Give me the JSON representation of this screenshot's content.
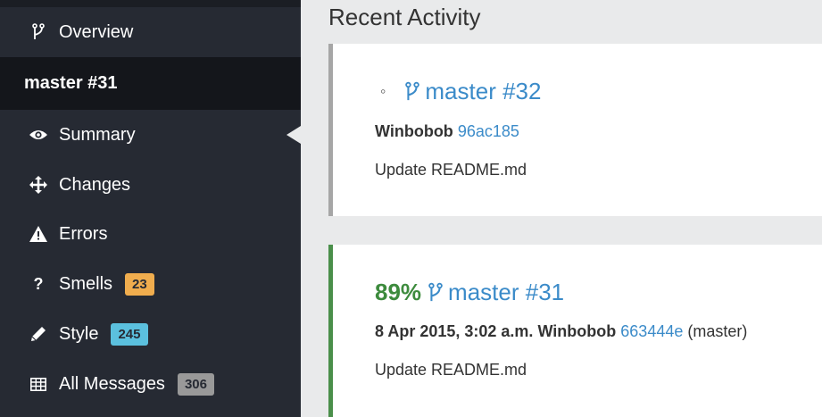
{
  "sidebar": {
    "overview_label": "Overview",
    "header": "master #31",
    "items": [
      {
        "label": "Summary",
        "icon": "eye-icon"
      },
      {
        "label": "Changes",
        "icon": "move-arrows-icon"
      },
      {
        "label": "Errors",
        "icon": "warning-icon"
      },
      {
        "label": "Smells",
        "icon": "question-icon",
        "badge": "23"
      },
      {
        "label": "Style",
        "icon": "pencil-icon",
        "badge": "245"
      },
      {
        "label": "All Messages",
        "icon": "table-icon",
        "badge": "306"
      }
    ]
  },
  "main": {
    "section_title": "Recent Activity",
    "activities": [
      {
        "bullet": "◦",
        "title": "master #32",
        "author": "Winbobob",
        "sha": "96ac185",
        "message": "Update README.md"
      },
      {
        "percent": "89%",
        "title": "master #31",
        "date": "8 Apr 2015, 3:02 a.m.",
        "author": "Winbobob",
        "sha": "663444e",
        "ref": "(master)",
        "message": "Update README.md"
      }
    ]
  },
  "colors": {
    "sidebar_bg": "#262a33",
    "link": "#3b8bc9",
    "success": "#3d8b3d",
    "badge_orange": "#f0ad4e",
    "badge_blue": "#5bc0de",
    "badge_grey": "#999999"
  }
}
